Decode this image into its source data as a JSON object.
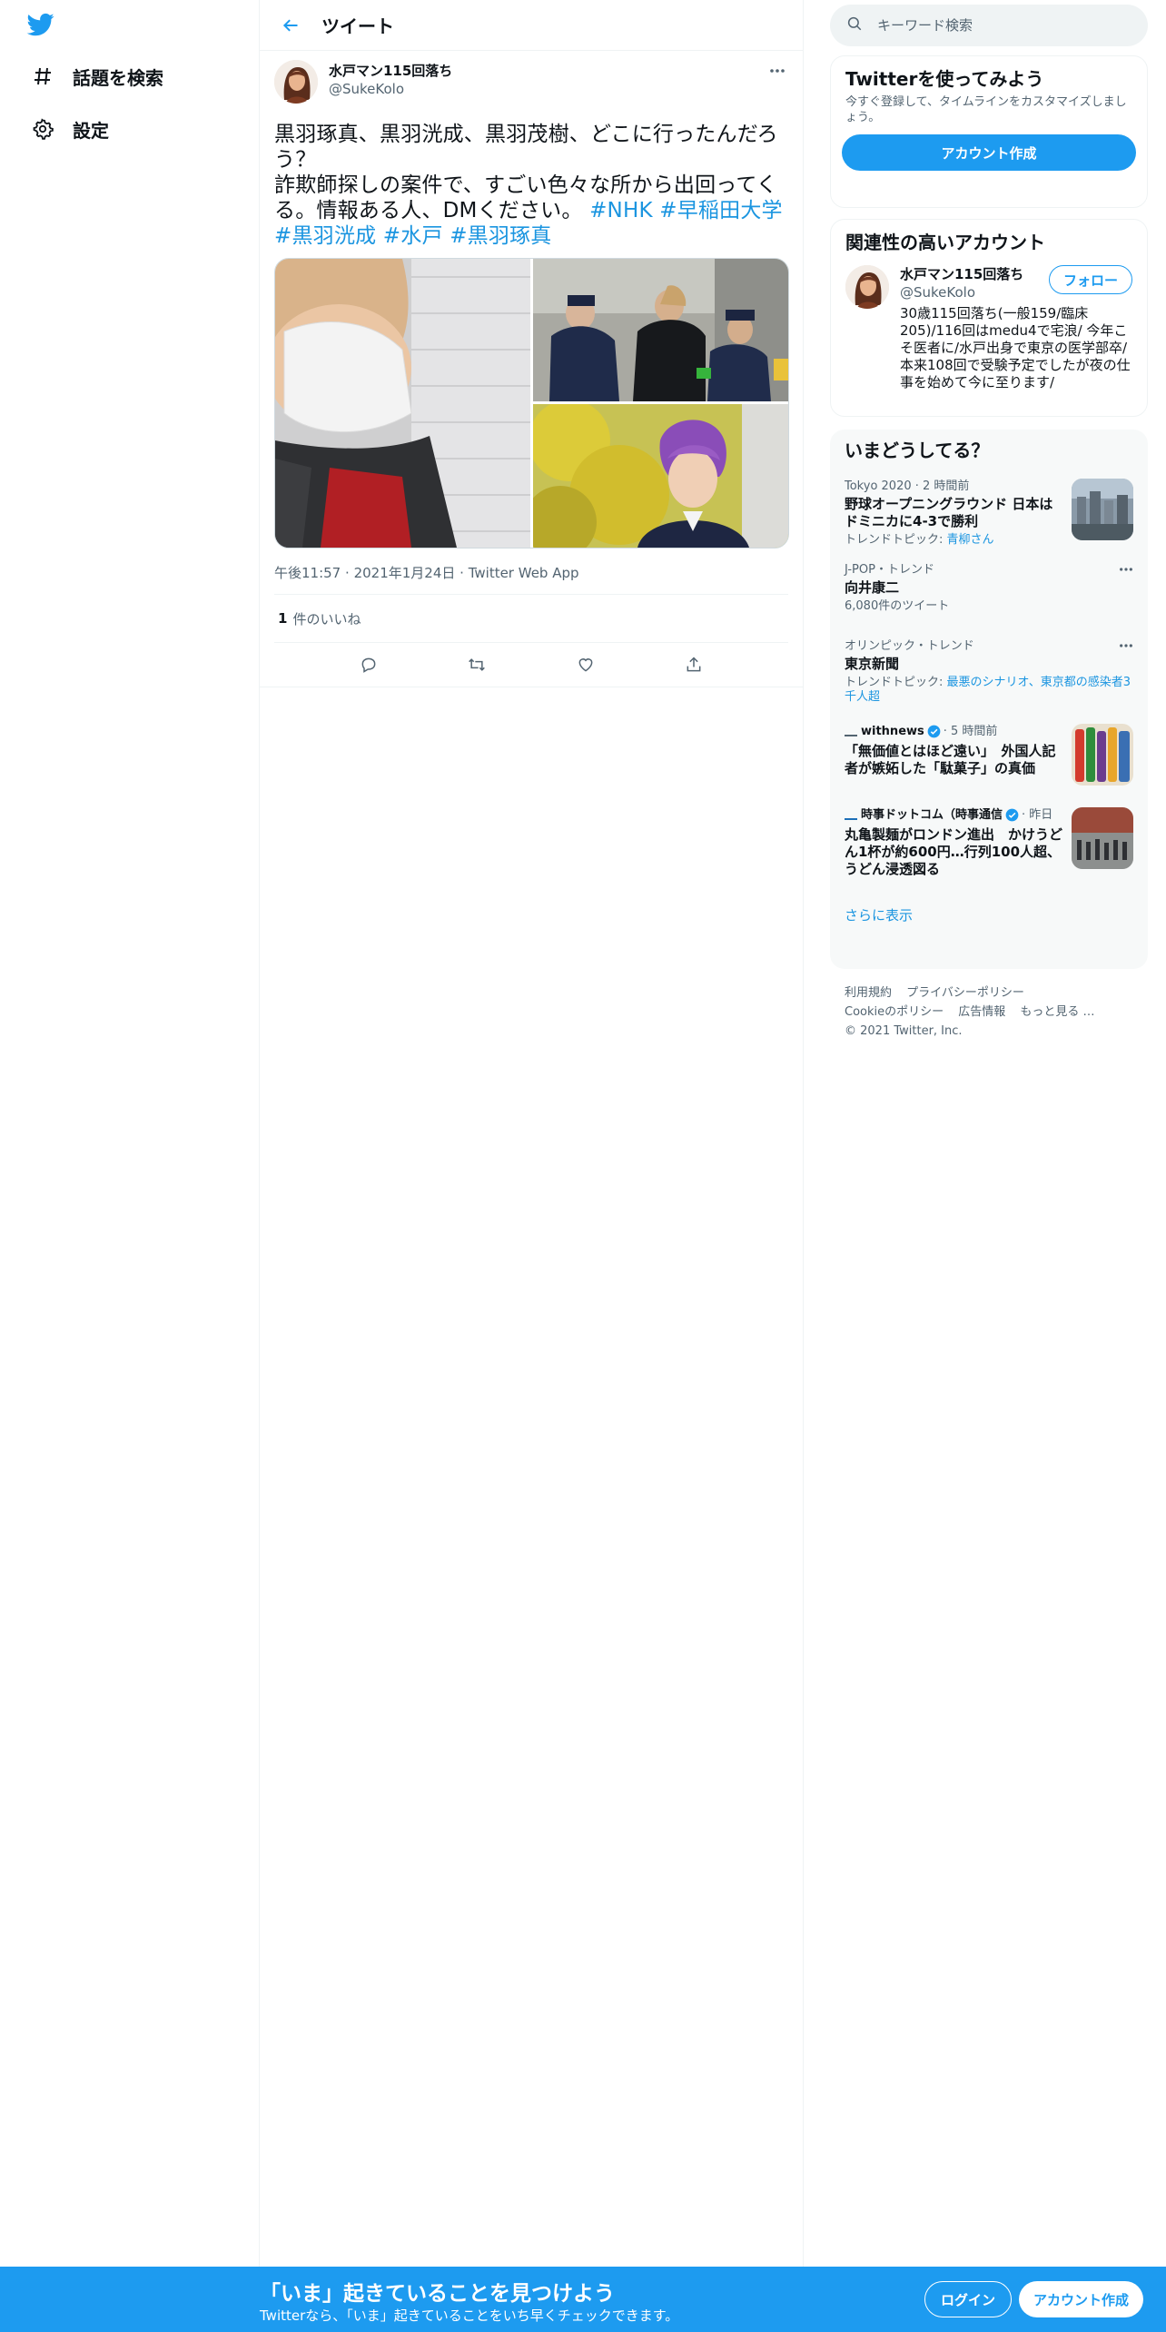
{
  "nav": {
    "explore_label": "話題を検索",
    "settings_label": "設定"
  },
  "header": {
    "title": "ツイート"
  },
  "tweet": {
    "author_name": "水戸マン115回落ち",
    "author_handle": "@SukeKolo",
    "text_line1": "黒羽琢真、黒羽洸成、黒羽茂樹、どこに行ったんだろう？",
    "text_line2": "詐欺師探しの案件で、すごい色々な所から出回ってくる。情報ある人、DMください。",
    "hashtags": [
      "#NHK",
      "#早稲田大学",
      "#黒羽洸成",
      "#水戸",
      "#黒羽琢真"
    ],
    "time": "午後11:57",
    "date": "2021年1月24日",
    "client": "Twitter Web App",
    "likes_count": "1",
    "likes_label": "件のいいね"
  },
  "search": {
    "placeholder": "キーワード検索"
  },
  "signup_card": {
    "title": "Twitterを使ってみよう",
    "subtitle": "今すぐ登録して、タイムラインをカスタマイズしましょう。",
    "button": "アカウント作成"
  },
  "related": {
    "title": "関連性の高いアカウント",
    "name": "水戸マン115回落ち",
    "handle": "@SukeKolo",
    "follow": "フォロー",
    "bio": "30歳115回落ち(一般159/臨床205)/116回はmedu4で宅浪/ 今年こそ医者に/水戸出身で東京の医学部卒/ 本来108回で受験予定でしたが夜の仕事を始めて今に至ります/"
  },
  "trends": {
    "title": "いまどうしてる？",
    "items": [
      {
        "category": "Tokyo 2020",
        "time": "2 時間前",
        "title": "野球オープニングラウンド 日本はドミニカに4-3で勝利",
        "sub_prefix": "トレンドトピック: ",
        "sub_link": "青柳さん"
      },
      {
        "category": "J-POP・トレンド",
        "title": "向井康二",
        "sub": "6,080件のツイート"
      },
      {
        "category": "オリンピック・トレンド",
        "title": "東京新聞",
        "sub_prefix": "トレンドトピック: ",
        "sub_link": "最悪のシナリオ、東京都の感染者3千人超"
      },
      {
        "source": "withnews",
        "time": "5 時間前",
        "title": "「無価値とはほど遠い」　外国人記者が嫉妬した「駄菓子」の真価"
      },
      {
        "source": "時事ドットコム（時事通信",
        "time": "昨日",
        "title": "丸亀製麺がロンドン進出　かけうどん1杯が約600円…行列100人超、うどん浸透図る"
      }
    ],
    "show_more": "さらに表示"
  },
  "footer": {
    "terms": "利用規約",
    "privacy": "プライバシーポリシー",
    "cookie": "Cookieのポリシー",
    "ads": "広告情報",
    "more": "もっと見る …",
    "copyright": "© 2021 Twitter, Inc."
  },
  "bottombar": {
    "title": "「いま」起きていることを見つけよう",
    "subtitle": "Twitterなら、「いま」起きていることをいち早くチェックできます。",
    "login": "ログイン",
    "signup": "アカウント作成"
  },
  "colors": {
    "accent": "#1d9bf0",
    "link": "#1b95e0",
    "text": "#0f1419",
    "secondary": "#536471"
  },
  "icons": [
    "twitter-bird-icon",
    "hashtag-icon",
    "gear-icon",
    "back-arrow-icon",
    "more-icon",
    "reply-icon",
    "retweet-icon",
    "like-icon",
    "share-icon",
    "search-icon",
    "verified-icon"
  ]
}
